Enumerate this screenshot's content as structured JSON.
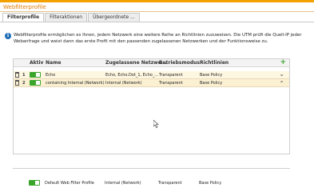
{
  "page": {
    "title": "Webfilterprofile"
  },
  "tabs": [
    {
      "label": "Filterprofile",
      "active": true
    },
    {
      "label": "Filteraktionen",
      "active": false
    },
    {
      "label": "Übergeordnete ...",
      "active": false
    }
  ],
  "info": {
    "text": "Webfilterprofile ermöglichen es Ihnen, jedem Netzwerk eine weitere Reihe an Richtlinien zuzuweisen. Die UTM prüft die Quell-IP jeder Webanfrage und weist dann das erste Profil mit den passenden zugelassenen Netzwerken und der Funktionsweise zu.",
    "icon": "info-icon"
  },
  "table": {
    "headers": {
      "active": "Aktiv",
      "name": "Name",
      "networks": "Zugelassene Netzwe...",
      "mode": "Betriebsmodus",
      "policies": "Richtlinien"
    },
    "rows": [
      {
        "num": "1",
        "name": "Echo",
        "networks": "Echo, Echo.Dot_1, Echo_...",
        "mode": "Transparent",
        "policy": "Base Policy"
      },
      {
        "num": "2",
        "name": "containing Internal (Network)",
        "networks": "Internal (Network)",
        "mode": "Transparent",
        "policy": "Base Policy"
      }
    ]
  },
  "default_profile": {
    "name": "Default Web Filter Profile",
    "networks": "Internal (Network)",
    "mode": "Transparent",
    "policy": "Base Policy"
  },
  "colors": {
    "accent": "#f2a100",
    "toggle_on": "#3aa52b",
    "info": "#1f6db5"
  }
}
